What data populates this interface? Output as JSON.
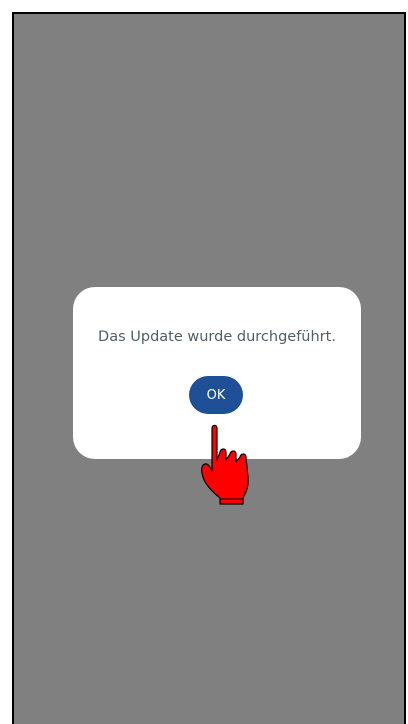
{
  "dialog": {
    "message": "Das Update wurde durchgeführt.",
    "ok_label": "OK"
  },
  "colors": {
    "overlay": "#808080",
    "dialog_background": "#ffffff",
    "message_text": "#4f5f66",
    "button_background": "#1f4f97",
    "button_text": "#ffffff",
    "pointer": "#ff0000"
  },
  "icons": {
    "pointer": "pointing-hand-icon"
  }
}
